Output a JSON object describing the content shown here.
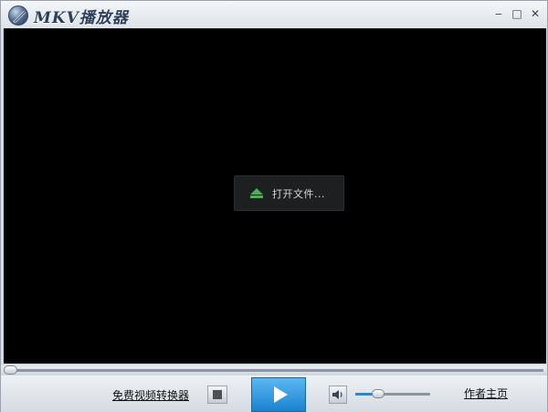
{
  "window": {
    "title": "MKV播放器",
    "minimize_glyph": "‒",
    "maximize_glyph": "□",
    "close_glyph": "✕"
  },
  "video": {
    "open_file_label": "打开文件...",
    "open_icon": "eject-icon"
  },
  "seek": {
    "position": 0
  },
  "controls": {
    "converter_link": "免费视频转换器",
    "author_link": "作者主页",
    "stop_icon": "stop-icon",
    "play_icon": "play-icon",
    "volume_icon": "speaker-icon",
    "volume_level": 0.3
  },
  "colors": {
    "play_button": "#2a92dc",
    "open_icon": "#47b24f",
    "video_bg": "#000000"
  }
}
